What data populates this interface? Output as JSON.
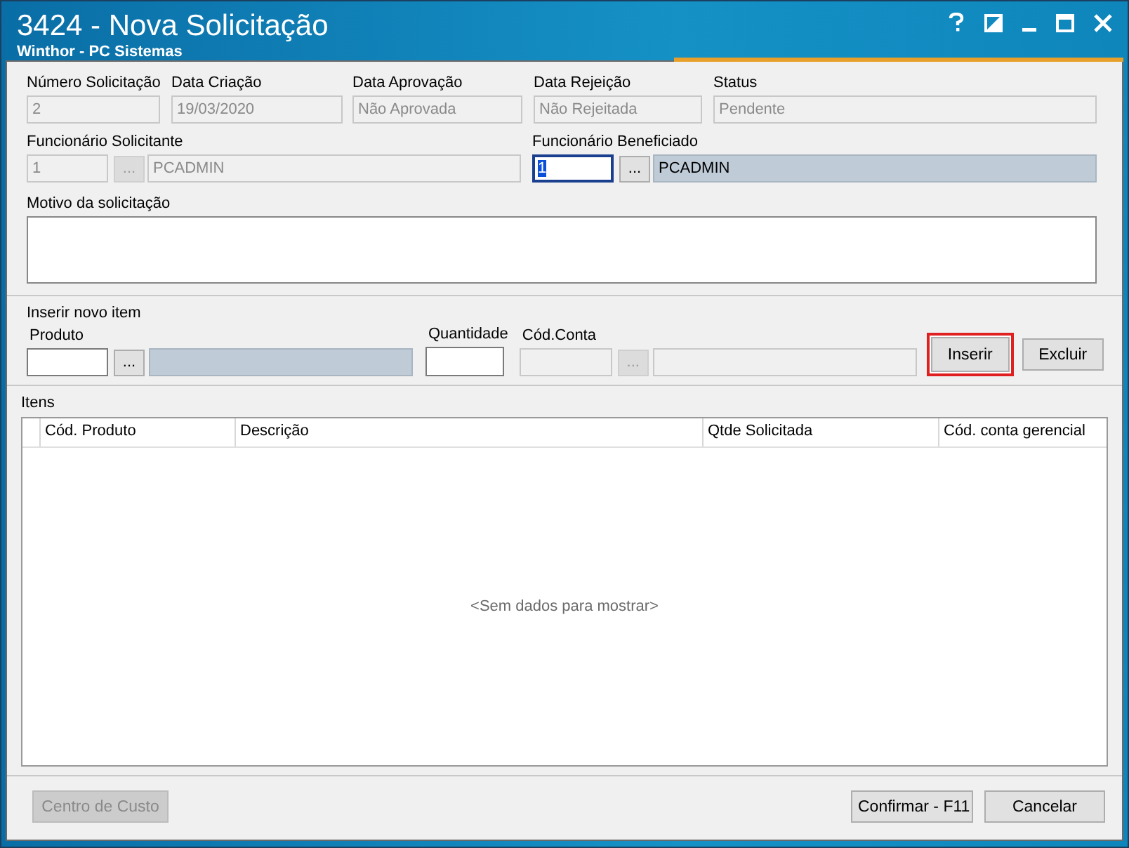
{
  "window": {
    "title": "3424 - Nova Solicitação",
    "subtitle": "Winthor - PC Sistemas"
  },
  "header_fields": [
    {
      "label": "Número Solicitação",
      "value": "2",
      "disabled": true
    },
    {
      "label": "Data Criação",
      "value": "19/03/2020",
      "disabled": true
    },
    {
      "label": "Data Aprovação",
      "value": "Não Aprovada",
      "disabled": true
    },
    {
      "label": "Data Rejeição",
      "value": "Não Rejeitada",
      "disabled": true
    },
    {
      "label": "Status",
      "value": "Pendente",
      "disabled": true
    }
  ],
  "employees": [
    {
      "label": "Funcionário Solicitante",
      "code": {
        "value": "1",
        "disabled": true,
        "focused": false
      },
      "lookup": {
        "label": "...",
        "disabled": true
      },
      "name": {
        "value": "PCADMIN",
        "disabled": true,
        "readonly": false
      }
    },
    {
      "label": "Funcionário Beneficiado",
      "code": {
        "value": "1",
        "disabled": false,
        "focused": true
      },
      "lookup": {
        "label": "...",
        "disabled": false
      },
      "name": {
        "value": "PCADMIN",
        "disabled": false,
        "readonly": true
      }
    }
  ],
  "reason": {
    "label": "Motivo da solicitação"
  },
  "insert_group": {
    "title": "Inserir novo item",
    "product": {
      "label": "Produto",
      "code_disabled": false,
      "lookup": {
        "label": "...",
        "disabled": false
      },
      "name_readonly": true
    },
    "quantity": {
      "label": "Quantidade"
    },
    "account": {
      "label": "Cód.Conta",
      "code_disabled": true,
      "lookup": {
        "label": "...",
        "disabled": true
      },
      "name_disabled": true
    },
    "buttons": [
      {
        "label": "Inserir",
        "highlighted": true
      },
      {
        "label": "Excluir",
        "highlighted": false
      }
    ]
  },
  "items": {
    "title": "Itens",
    "columns": [
      "Cód. Produto",
      "Descrição",
      "Qtde Solicitada",
      "Cód. conta gerencial"
    ],
    "empty_text": "<Sem dados para mostrar>"
  },
  "footer_buttons": [
    {
      "label": "Centro de Custo",
      "disabled": true
    },
    {
      "label": "Confirmar - F11",
      "disabled": false
    },
    {
      "label": "Cancelar",
      "disabled": false
    }
  ]
}
